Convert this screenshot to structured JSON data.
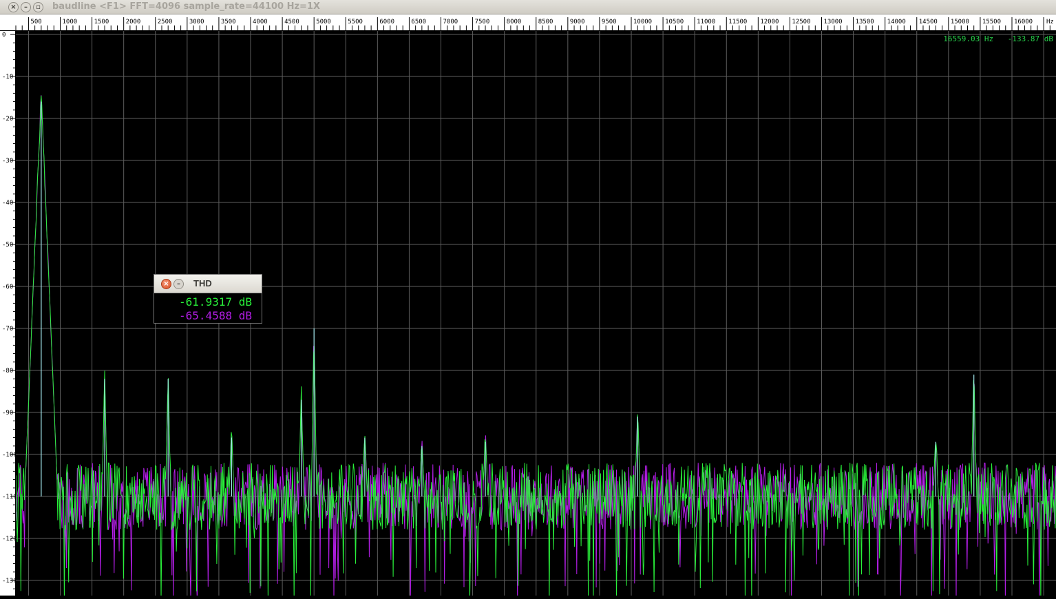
{
  "window": {
    "title": "baudline  <F1> FFT=4096 sample_rate=44100 Hz=1X",
    "close_glyph": "×",
    "min_glyph": "–",
    "max_glyph": "▫"
  },
  "x_axis": {
    "unit_label": "Hz",
    "tick_labels": [
      "500",
      "1000",
      "1500",
      "2000",
      "2500",
      "3000",
      "3500",
      "4000",
      "4500",
      "5000",
      "5500",
      "6000",
      "6500",
      "7000",
      "7500",
      "8000",
      "8500",
      "9000",
      "9500",
      "10000",
      "10500",
      "11000",
      "11500",
      "12000",
      "12500",
      "13000",
      "13500",
      "14000",
      "14500",
      "15000",
      "15500",
      "16000"
    ]
  },
  "y_axis": {
    "tick_labels": [
      "0",
      "-10",
      "-20",
      "-30",
      "-40",
      "-50",
      "-60",
      "-70",
      "-80",
      "-90",
      "-100",
      "-110",
      "-120",
      "-130"
    ]
  },
  "cursor_readout": {
    "frequency": "16559.03 Hz",
    "level": "-133.87 dB"
  },
  "thd_dialog": {
    "title": "THD",
    "close_glyph": "×",
    "min_glyph": "–",
    "channel_1_value": "-61.9317 dB",
    "channel_2_value": "-65.4588 dB"
  },
  "colors": {
    "channel_1": "#29f03a",
    "channel_2": "#b31ee6",
    "overlap": "#a6ecf2",
    "grid": "#5e5e5e"
  },
  "chart_data": {
    "type": "line",
    "x_unit": "Hz",
    "y_unit": "dB",
    "xlim": [
      0,
      16600
    ],
    "ylim": [
      -135,
      0
    ],
    "noise_floor": -110,
    "peaks": [
      {
        "x": 700,
        "y": -16
      },
      {
        "x": 1700,
        "y": -82
      },
      {
        "x": 2700,
        "y": -82
      },
      {
        "x": 3700,
        "y": -96
      },
      {
        "x": 5000,
        "y": -70
      },
      {
        "x": 4800,
        "y": -87
      },
      {
        "x": 5800,
        "y": -96
      },
      {
        "x": 6700,
        "y": -98
      },
      {
        "x": 7700,
        "y": -97
      },
      {
        "x": 10100,
        "y": -91
      },
      {
        "x": 15400,
        "y": -81
      },
      {
        "x": 14800,
        "y": -97
      }
    ]
  }
}
